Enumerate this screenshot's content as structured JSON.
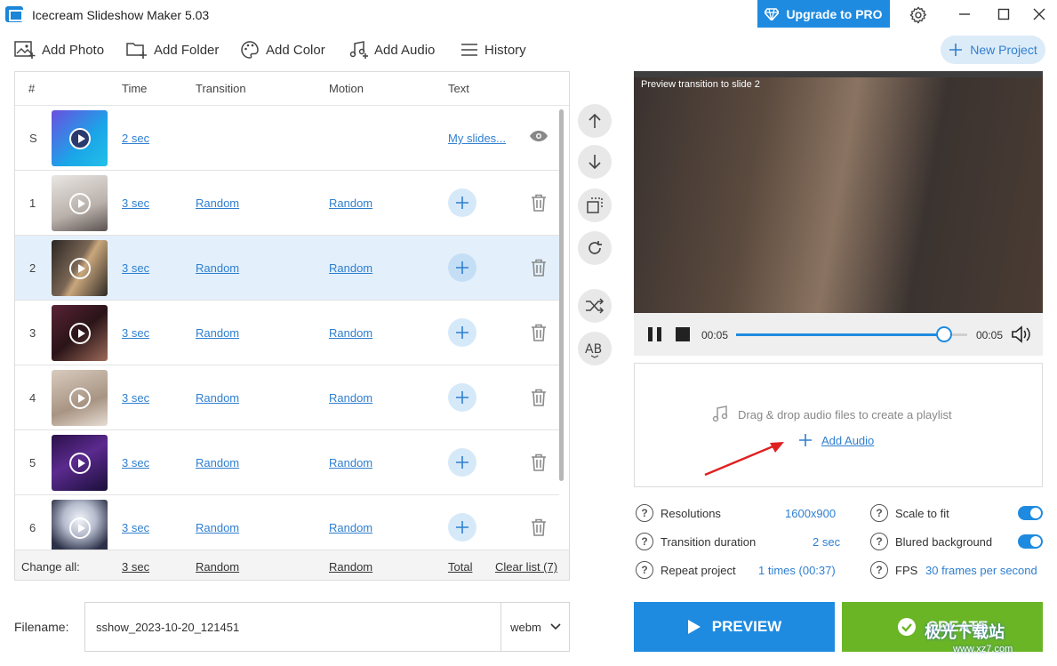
{
  "app": {
    "title": "Icecream Slideshow Maker 5.03",
    "upgrade_label": "Upgrade to PRO",
    "new_project_label": "New Project",
    "accent_color": "#1e8be0",
    "create_color": "#6ab526"
  },
  "toolbar": {
    "add_photo": "Add Photo",
    "add_folder": "Add Folder",
    "add_color": "Add Color",
    "add_audio": "Add Audio",
    "history": "History"
  },
  "list": {
    "headers": {
      "num": "#",
      "time": "Time",
      "transition": "Transition",
      "motion": "Motion",
      "text": "Text"
    },
    "start_row": {
      "num": "S",
      "time": "2 sec",
      "text": "My slides..."
    },
    "rows": [
      {
        "num": "1",
        "time": "3 sec",
        "transition": "Random",
        "motion": "Random"
      },
      {
        "num": "2",
        "time": "3 sec",
        "transition": "Random",
        "motion": "Random"
      },
      {
        "num": "3",
        "time": "3 sec",
        "transition": "Random",
        "motion": "Random"
      },
      {
        "num": "4",
        "time": "3 sec",
        "transition": "Random",
        "motion": "Random"
      },
      {
        "num": "5",
        "time": "3 sec",
        "transition": "Random",
        "motion": "Random"
      },
      {
        "num": "6",
        "time": "3 sec",
        "transition": "Random",
        "motion": "Random"
      }
    ],
    "footer": {
      "change_all": "Change all:",
      "time": "3 sec",
      "transition": "Random",
      "motion": "Random",
      "total": "Total",
      "clear_list": "Clear list (7)"
    }
  },
  "filename": {
    "label": "Filename:",
    "value": "sshow_2023-10-20_121451",
    "format": "webm"
  },
  "preview": {
    "label": "Preview transition to slide 2",
    "current_time": "00:05",
    "total_time": "00:05",
    "progress": 0.9
  },
  "audio": {
    "drop_text": "Drag & drop audio files to create a playlist",
    "add_audio": "Add Audio"
  },
  "settings": {
    "resolutions_label": "Resolutions",
    "resolutions_value": "1600x900",
    "transition_duration_label": "Transition duration",
    "transition_duration_value": "2 sec",
    "repeat_label": "Repeat project",
    "repeat_value": "1 times (00:37)",
    "scale_label": "Scale to fit",
    "scale_on": true,
    "blur_label": "Blured background",
    "blur_on": true,
    "fps_label": "FPS",
    "fps_value": "30 frames per second"
  },
  "actions": {
    "preview": "PREVIEW",
    "create": "CREATE"
  },
  "watermark": {
    "main": "极光下载站",
    "sub": "www.xz7.com"
  }
}
